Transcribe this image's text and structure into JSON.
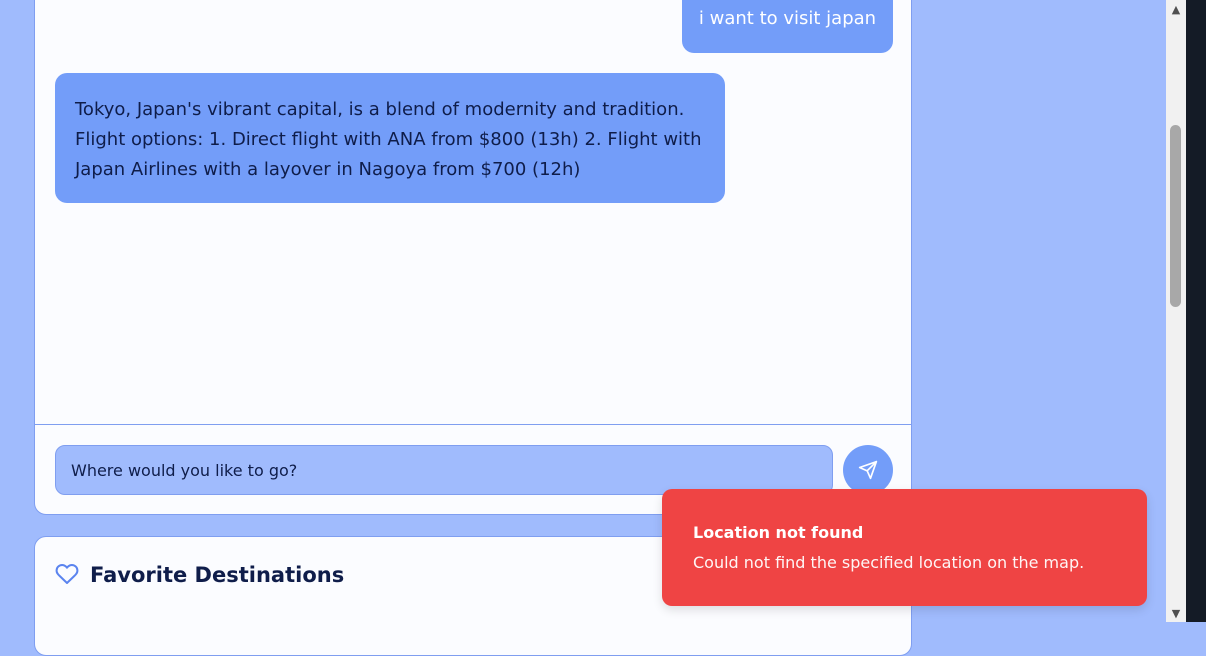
{
  "chat": {
    "messages": [
      {
        "role": "user",
        "text": "i want to visit japan"
      },
      {
        "role": "assistant",
        "text": "Tokyo, Japan's vibrant capital, is a blend of modernity and tradition. Flight options: 1. Direct flight with ANA from $800 (13h) 2. Flight with Japan Airlines with a layover in Nagoya from $700 (12h)"
      }
    ],
    "input": {
      "placeholder": "Where would you like to go?",
      "value": ""
    },
    "send_icon": "send-icon"
  },
  "favorites": {
    "title": "Favorite Destinations",
    "icon": "heart-icon"
  },
  "toast": {
    "title": "Location not found",
    "description": "Could not find the specified location on the map."
  },
  "colors": {
    "page_background": "#a0bbfd",
    "bubble": "#739df9",
    "toast_background": "#ef4444",
    "card_background": "#fbfcff"
  }
}
